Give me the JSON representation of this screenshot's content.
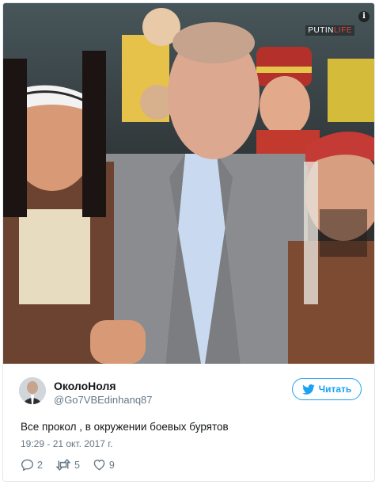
{
  "photo": {
    "watermark_left": "PUTIN",
    "watermark_right": "LIFE",
    "info_icon": "info-icon"
  },
  "tweet": {
    "author_name": "ОколоНоля",
    "author_handle": "@Go7VBEdinhanq87",
    "follow_label": "Читать",
    "text": "Все прокол , в окружении боевых бурятов",
    "timestamp": "19:29 - 21 окт. 2017 г.",
    "replies": "2",
    "retweets": "5",
    "likes": "9"
  },
  "colors": {
    "accent": "#1da1f2",
    "muted": "#657786",
    "text": "#14171a"
  }
}
